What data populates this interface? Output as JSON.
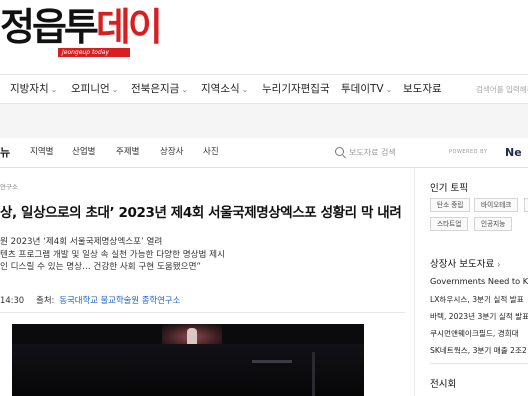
{
  "header": {
    "logo_text_a": "정읍투",
    "logo_text_b": "데이",
    "logo_sub": "Jeongeup today"
  },
  "main_nav": {
    "items": [
      {
        "label": "지방자치",
        "has_dropdown": true
      },
      {
        "label": "오피니언",
        "has_dropdown": true
      },
      {
        "label": "전북은지금",
        "has_dropdown": true
      },
      {
        "label": "지역소식",
        "has_dropdown": true
      },
      {
        "label": "누리기자편집국",
        "has_dropdown": false
      },
      {
        "label": "투데이TV",
        "has_dropdown": true
      },
      {
        "label": "보도자료",
        "has_dropdown": false
      }
    ],
    "search_placeholder": "검색어를 입력해주"
  },
  "sub_nav": {
    "brand": "뉴",
    "items": [
      "지역별",
      "산업별",
      "주제별",
      "상장사",
      "사진"
    ],
    "search_placeholder": "보도자료 검색",
    "powered_by": "POWERED BY",
    "powered_brand": "Ne"
  },
  "article": {
    "breadcrumb": "연구소",
    "title": "상, 일상으로의 초대’ 2023년 제4회 서울국제명상엑스포 성황리 막 내려",
    "subtitles": [
      "원 2023년 ‘제4회 서울국제명상엑스포’ 열려",
      "텐츠 프로그램 개발 및 일상 속 실천 가능한 다양한 명상법 제시",
      "인 디스릴 수 있는 명상… 건강한 사회 구현 도움됐으면”"
    ],
    "time": "14:30",
    "source_label": "출처:",
    "source": "동국대학교 불교학술원 종학연구소"
  },
  "sidebar": {
    "hot_topics_title": "인기 토픽",
    "tags": [
      "탄소 중립",
      "바이오테크",
      "로",
      "스타트업",
      "인공지능"
    ],
    "listed_title": "상장사 보도자료",
    "listed_items": [
      "Governments Need to Kee",
      "LX하우시스, 3분기 실적 발표",
      "바텍, 2023년 3분기 실적 발표",
      "쿠시먼앤웨이크필드, 경희대",
      "SK네트웍스, 3분기 매출 2조2"
    ],
    "exhibition_title": "전시회"
  }
}
